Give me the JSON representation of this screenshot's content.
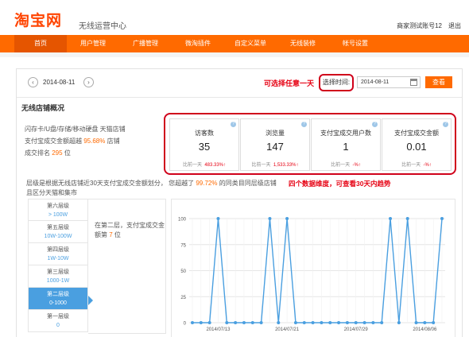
{
  "header": {
    "logo": "淘宝网",
    "subtitle": "无线运营中心",
    "account": "商家测试账号12",
    "logout": "退出"
  },
  "nav": {
    "items": [
      "首页",
      "用户管理",
      "广播管理",
      "微淘插件",
      "自定义菜单",
      "无线装修",
      "帐号设置"
    ],
    "active": 0
  },
  "colors": {
    "brand": "#ff6a00",
    "highlight_red": "#e60012",
    "series": "#4a9fe0"
  },
  "date_bar": {
    "prev_icon": "chevron-left-icon",
    "next_icon": "chevron-right-icon",
    "current_date": "2014-08-11",
    "hint": "可选择任意一天",
    "picker_label": "选择时间:",
    "picker_value": "2014-08-11",
    "calendar_icon": "calendar-icon",
    "query_button": "查看"
  },
  "overview": {
    "title": "无线店铺概况",
    "shop_line1": "闪存卡/U盘/存储/移动硬盘 天猫店铺",
    "shop_line2_prefix": "支付宝成交金额超越",
    "shop_line2_pct": "95.68%",
    "shop_line2_suffix": "店铺",
    "shop_line3_prefix": "成交排名",
    "shop_line3_rank": "295",
    "shop_line3_suffix": "位"
  },
  "metrics": [
    {
      "label": "访客数",
      "value": "35",
      "compare_label": "比前一天",
      "delta": "483.33%↑"
    },
    {
      "label": "浏览量",
      "value": "147",
      "compare_label": "比前一天",
      "delta": "1,533.33%↑"
    },
    {
      "label": "支付宝成交用户数",
      "value": "1",
      "compare_label": "比前一天",
      "delta": "-%↑"
    },
    {
      "label": "支付宝成交金额",
      "value": "0.01",
      "compare_label": "比前一天",
      "delta": "-%↑"
    }
  ],
  "tier_section": {
    "desc_prefix": "层级是根据无线店铺近30天支付宝成交金额划分，  您超越了",
    "desc_pct": "99.72%",
    "desc_suffix": "的同类目同层级店铺",
    "desc_line2": "且区分天猫和集市",
    "trend_note": "四个数据维度，可查看30天内趋势",
    "tiers": [
      {
        "name": "第六层级",
        "range": "> 100W"
      },
      {
        "name": "第五层级",
        "range": "10W-100W"
      },
      {
        "name": "第四层级",
        "range": "1W-10W"
      },
      {
        "name": "第三层级",
        "range": "1000-1W"
      },
      {
        "name": "第二层级",
        "range": "0-1000"
      },
      {
        "name": "第一层级",
        "range": "0"
      }
    ],
    "active_tier": 4,
    "detail_prefix": "在第二层，支付宝成交金",
    "detail_mid": "额第",
    "detail_rank": "7",
    "detail_suffix": "位"
  },
  "chart_data": {
    "type": "line",
    "y_ticks": [
      0,
      25,
      50,
      75,
      100
    ],
    "ylim": [
      0,
      100
    ],
    "x_tick_labels": [
      "2014/07/13",
      "2014/07/21",
      "2014/07/29",
      "2014/08/06"
    ],
    "x_tick_indices": [
      3,
      11,
      19,
      27
    ],
    "values": [
      0,
      0,
      0,
      100,
      0,
      0,
      0,
      0,
      0,
      100,
      0,
      100,
      0,
      0,
      0,
      0,
      0,
      0,
      0,
      0,
      0,
      0,
      0,
      100,
      0,
      100,
      0,
      0,
      0,
      100
    ],
    "grid": true
  }
}
